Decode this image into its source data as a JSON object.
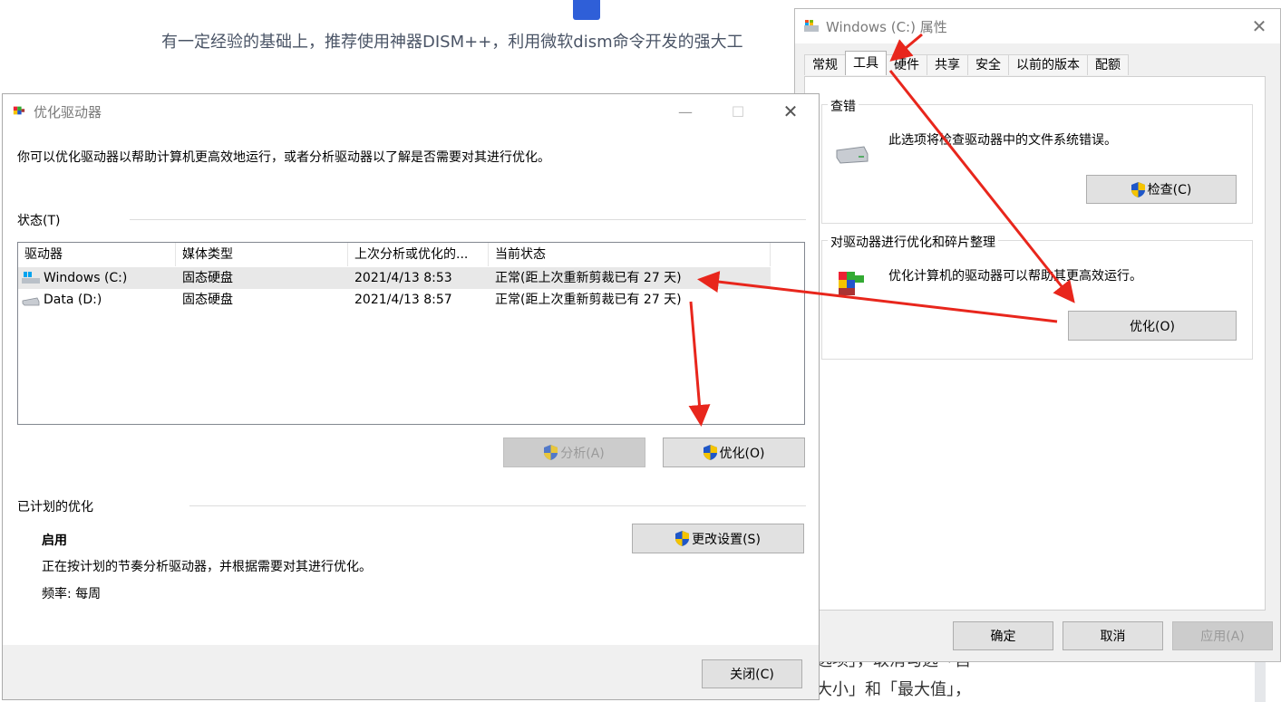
{
  "background": {
    "headline": "有一定经验的基础上，推荐使用神器DISM++，利用微软dism命令开发的强大工",
    "bottom_line1": "选项」，取消勾选「自",
    "bottom_line2": "大小」和「最大值」，"
  },
  "properties_window": {
    "title": "Windows (C:) 属性",
    "tabs": [
      "常规",
      "工具",
      "硬件",
      "共享",
      "安全",
      "以前的版本",
      "配额"
    ],
    "active_tab": "工具",
    "check_group": {
      "title": "查错",
      "description": "此选项将检查驱动器中的文件系统错误。",
      "button": "检查(C)"
    },
    "optimize_group": {
      "title": "对驱动器进行优化和碎片整理",
      "description": "优化计算机的驱动器可以帮助其更高效运行。",
      "button": "优化(O)"
    },
    "buttons": {
      "ok": "确定",
      "cancel": "取消",
      "apply": "应用(A)"
    }
  },
  "optimize_window": {
    "title": "优化驱动器",
    "intro": "你可以优化驱动器以帮助计算机更高效地运行，或者分析驱动器以了解是否需要对其进行优化。",
    "status_label": "状态(T)",
    "columns": [
      "驱动器",
      "媒体类型",
      "上次分析或优化的...",
      "当前状态"
    ],
    "drives": [
      {
        "name": "Windows (C:)",
        "media": "固态硬盘",
        "last": "2021/4/13 8:53",
        "status": "正常(距上次重新剪裁已有 27 天)"
      },
      {
        "name": "Data (D:)",
        "media": "固态硬盘",
        "last": "2021/4/13 8:57",
        "status": "正常(距上次重新剪裁已有 27 天)"
      }
    ],
    "analyze_button": "分析(A)",
    "optimize_button": "优化(O)",
    "scheduled_label": "已计划的优化",
    "scheduled_state": "启用",
    "scheduled_desc": "正在按计划的节奏分析驱动器，并根据需要对其进行优化。",
    "frequency": "频率: 每周",
    "change_settings_button": "更改设置(S)",
    "close_button": "关闭(C)"
  },
  "colors": {
    "arrow": "#e8261c",
    "shield_blue": "#1f57c8",
    "shield_yellow": "#f5c400"
  }
}
